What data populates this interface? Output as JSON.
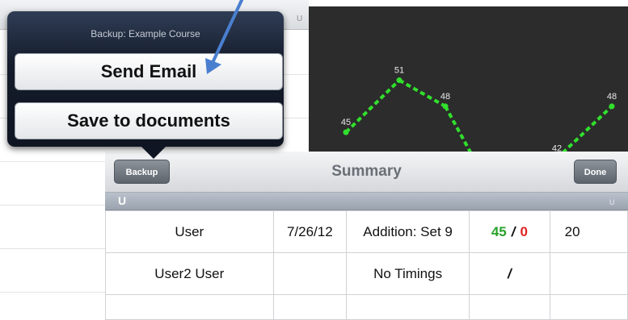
{
  "popover": {
    "title": "Backup: Example Course",
    "buttons": [
      {
        "label": "Send Email"
      },
      {
        "label": "Save to documents"
      }
    ]
  },
  "background": {
    "header_letter": "U"
  },
  "chart_data": {
    "type": "line",
    "points": [
      {
        "label": "45",
        "value": 45
      },
      {
        "label": "51",
        "value": 51
      },
      {
        "label": "48",
        "value": 48
      },
      {
        "label": "42",
        "value": 42
      },
      {
        "label": "48",
        "value": 48
      }
    ],
    "line_color": "#31e02c",
    "background_color": "#2c2c2c"
  },
  "summary": {
    "backup_label": "Backup",
    "title": "Summary",
    "done_label": "Done",
    "section_header": "U",
    "section_header_small": "U",
    "rows": [
      {
        "name": "User",
        "date": "7/26/12",
        "test": "Addition: Set 9",
        "correct": "45",
        "incorrect": "0",
        "extra": "20"
      },
      {
        "name": "User2 User",
        "date": "",
        "test": "No Timings",
        "correct": "",
        "incorrect": "",
        "extra": ""
      }
    ]
  },
  "colors": {
    "correct": "#27a12a",
    "incorrect": "#e02222",
    "annotation_arrow": "#4a7fd0"
  }
}
